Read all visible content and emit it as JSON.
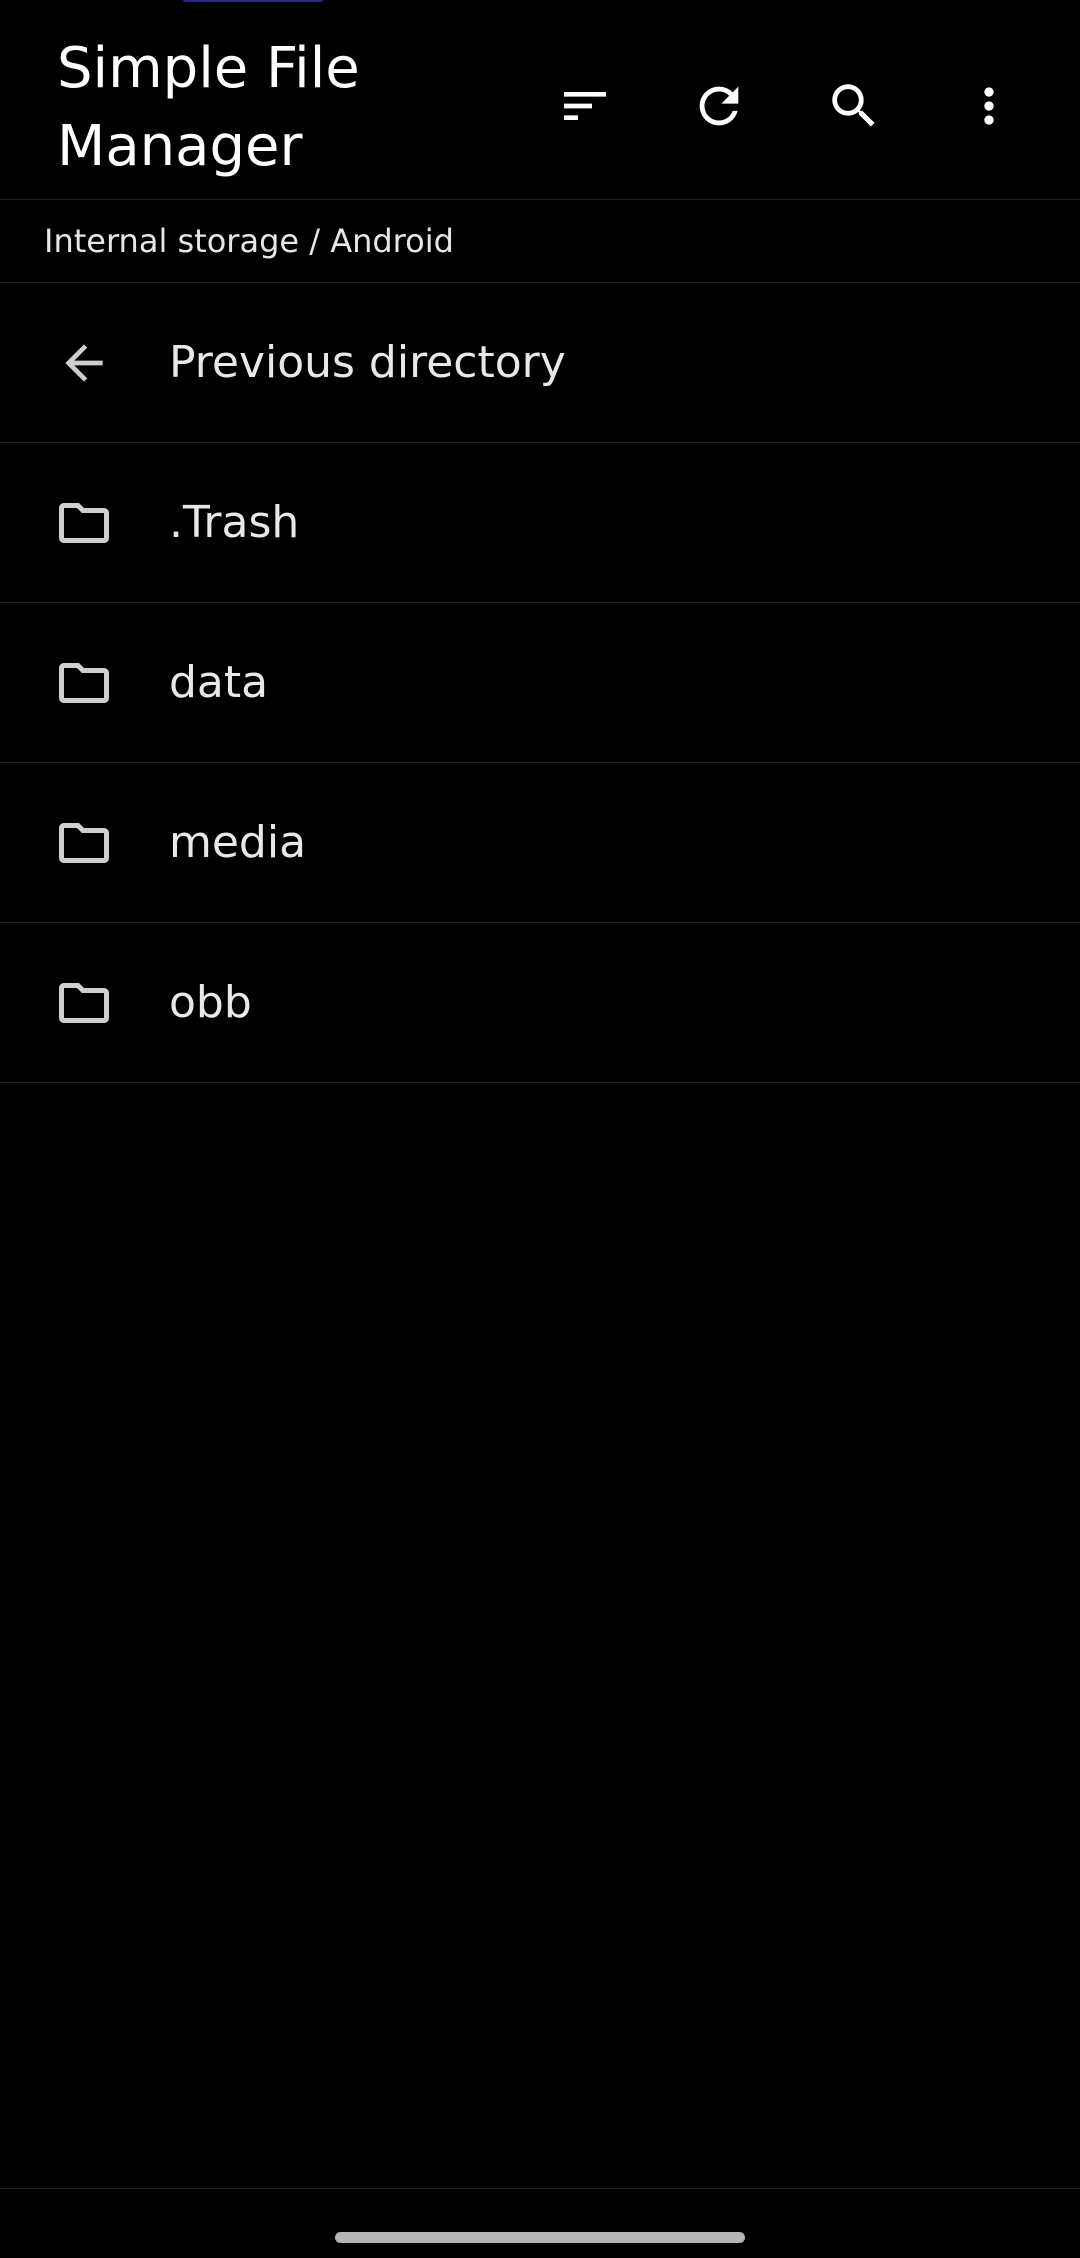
{
  "app": {
    "title": "Simple File Manager"
  },
  "toolbar": {
    "actions": [
      {
        "name": "sort",
        "icon": "sort-icon"
      },
      {
        "name": "refresh",
        "icon": "refresh-icon"
      },
      {
        "name": "search",
        "icon": "search-icon"
      },
      {
        "name": "more",
        "icon": "more-vert-icon"
      }
    ]
  },
  "breadcrumb": {
    "path": "Internal storage / Android"
  },
  "list": {
    "previous": {
      "label": "Previous directory",
      "icon": "arrow-back-icon"
    },
    "items": [
      {
        "label": ".Trash",
        "icon": "folder-icon"
      },
      {
        "label": "data",
        "icon": "folder-icon"
      },
      {
        "label": "media",
        "icon": "folder-icon"
      },
      {
        "label": "obb",
        "icon": "folder-icon"
      }
    ]
  },
  "colors": {
    "background": "#000000",
    "text": "#ffffff",
    "icon": "#ffffff",
    "divider": "#1e1e1e"
  }
}
